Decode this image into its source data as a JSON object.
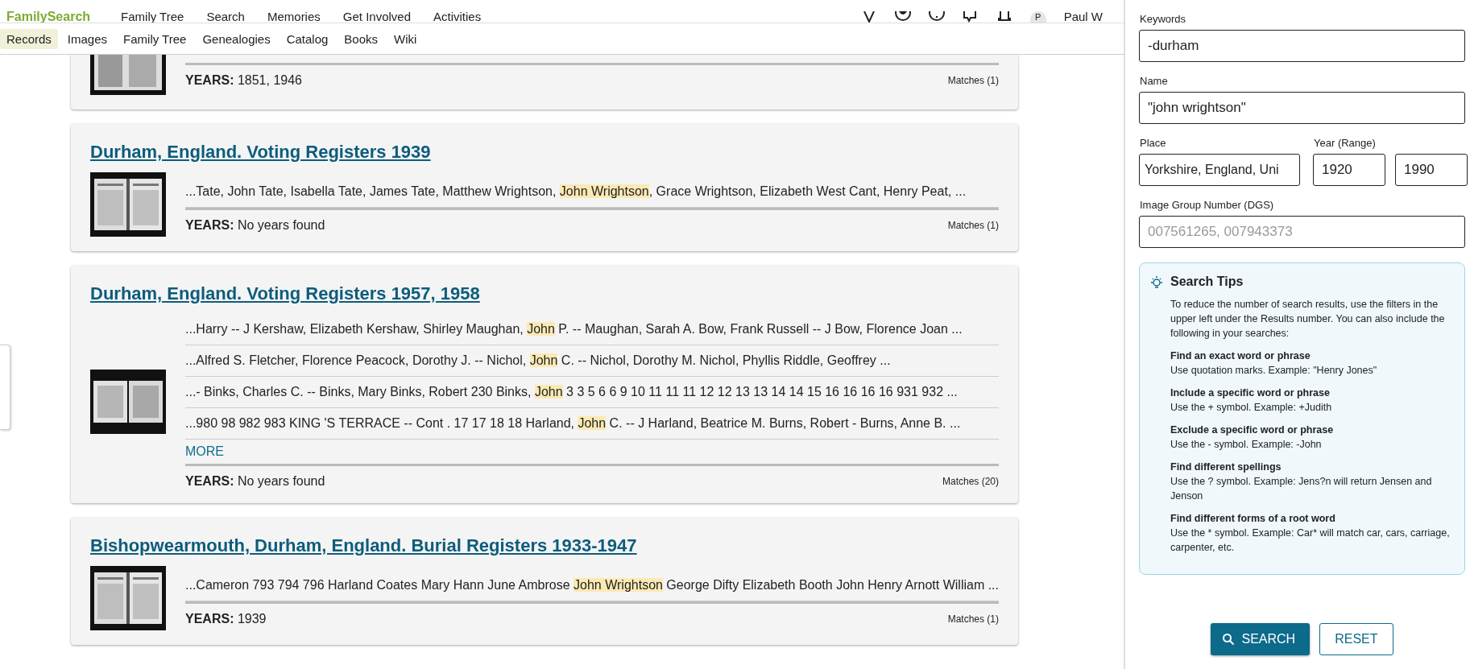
{
  "header": {
    "logo": "FamilySearch",
    "nav": [
      "Family Tree",
      "Search",
      "Memories",
      "Get Involved",
      "Activities"
    ],
    "user": {
      "initial": "P",
      "name": "Paul W"
    }
  },
  "subnav": [
    {
      "label": "Records",
      "selected": true
    },
    {
      "label": "Images",
      "selected": false
    },
    {
      "label": "Family Tree",
      "selected": false
    },
    {
      "label": "Genealogies",
      "selected": false
    },
    {
      "label": "Catalog",
      "selected": false
    },
    {
      "label": "Books",
      "selected": false
    },
    {
      "label": "Wiki",
      "selected": false
    }
  ],
  "results": [
    {
      "years_label": "YEARS:",
      "years": "1851, 1946",
      "matches": "Matches (1)"
    },
    {
      "title": "Durham, England. Voting Registers 1939",
      "snippets": [
        [
          {
            "text": "...Tate, John Tate, Isabella Tate, James Tate, Matthew Wrightson, ",
            "highlighted": false
          },
          {
            "text": "John Wrightson",
            "highlighted": true
          },
          {
            "text": ", Grace Wrightson, Elizabeth West Cant, Henry Peat, ...",
            "highlighted": false
          }
        ]
      ],
      "years_label": "YEARS:",
      "years": "No years found",
      "matches": "Matches (1)"
    },
    {
      "title": "Durham, England. Voting Registers 1957, 1958",
      "snippets": [
        [
          {
            "text": "...Harry -- J Kershaw, Elizabeth Kershaw, Shirley Maughan, ",
            "highlighted": false
          },
          {
            "text": "John",
            "highlighted": true
          },
          {
            "text": " P. -- Maughan, Sarah A. Bow, Frank Russell -- J Bow, Florence Joan ...",
            "highlighted": false
          }
        ],
        [
          {
            "text": "...Alfred S. Fletcher, Florence Peacock, Dorothy J. -- Nichol, ",
            "highlighted": false
          },
          {
            "text": "John",
            "highlighted": true
          },
          {
            "text": " C. -- Nichol, Dorothy M. Nichol, Phyllis Riddle, Geoffrey ...",
            "highlighted": false
          }
        ],
        [
          {
            "text": "...- Binks, Charles C. -- Binks, Mary Binks, Robert 230 Binks, ",
            "highlighted": false
          },
          {
            "text": "John",
            "highlighted": true
          },
          {
            "text": " 3 3 5 6 6 9 10 11 11 11 12 12 13 13 14 14 15 16 16 16 16 931 932 ...",
            "highlighted": false
          }
        ],
        [
          {
            "text": "...980 98 982 983 KING 'S TERRACE -- Cont . 17 17 18 18 Harland, ",
            "highlighted": false
          },
          {
            "text": "John",
            "highlighted": true
          },
          {
            "text": " C. -- J Harland, Beatrice M. Burns, Robert - Burns, Anne B. ...",
            "highlighted": false
          }
        ]
      ],
      "more": "MORE",
      "years_label": "YEARS:",
      "years": "No years found",
      "matches": "Matches (20)"
    },
    {
      "title": "Bishopwearmouth, Durham, England. Burial Registers 1933-1947",
      "snippets": [
        [
          {
            "text": "...Cameron 793 794 796 Harland Coates Mary Hann June Ambrose ",
            "highlighted": false
          },
          {
            "text": "John Wrightson",
            "highlighted": true
          },
          {
            "text": " George Difty Elizabeth Booth John Henry Arnott William ...",
            "highlighted": false
          }
        ]
      ],
      "years_label": "YEARS:",
      "years": "1939",
      "matches": "Matches (1)"
    }
  ],
  "panel": {
    "keywords": {
      "label": "Keywords",
      "value": "-durham"
    },
    "name": {
      "label": "Name",
      "value": "\"john wrightson\""
    },
    "place": {
      "label": "Place",
      "value": "Yorkshire, England, Uni"
    },
    "year": {
      "label": "Year (Range)",
      "from": "1920",
      "to": "1990"
    },
    "dgs": {
      "label": "Image Group Number (DGS)",
      "placeholder": "007561265, 007943373"
    },
    "tips": {
      "title": "Search Tips",
      "intro": "To reduce the number of search results, use the filters in the upper left under the Results number. You can also include the following in your searches:",
      "items": [
        {
          "heading": "Find an exact word or phrase",
          "text": "Use quotation marks. Example: \"Henry Jones\""
        },
        {
          "heading": "Include a specific word or phrase",
          "text": "Use the + symbol. Example: +Judith"
        },
        {
          "heading": "Exclude a specific word or phrase",
          "text": "Use the - symbol. Example: -John"
        },
        {
          "heading": "Find different spellings",
          "text": "Use the ? symbol. Example: Jens?n will return Jensen and Jenson"
        },
        {
          "heading": "Find different forms of a root word",
          "text": "Use the * symbol. Example: Car* will match car, cars, carriage, carpenter, etc."
        }
      ]
    },
    "search_button": "SEARCH",
    "reset_button": "RESET"
  }
}
